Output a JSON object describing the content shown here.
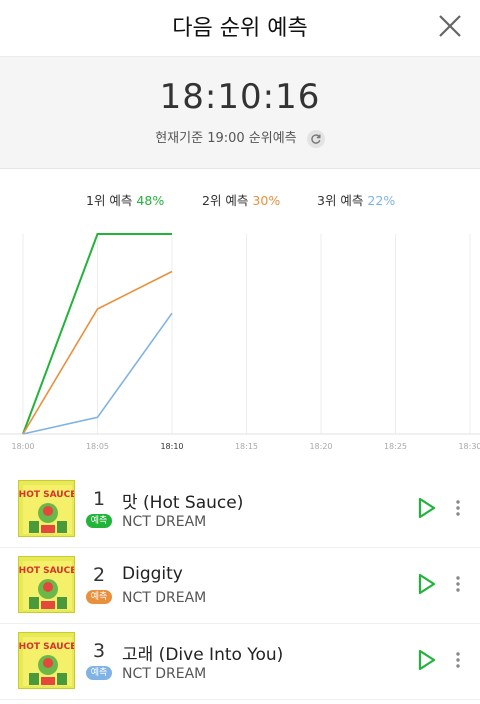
{
  "header": {
    "title": "다음 순위 예측",
    "close_icon": "close-icon"
  },
  "timer": {
    "clock": "18:10:16",
    "basis_text": "현재기준 19:00 순위예측",
    "refresh_icon": "refresh-icon"
  },
  "legend": [
    {
      "label": "1위 예측",
      "value": "48%",
      "color": "#22b33a"
    },
    {
      "label": "2위 예측",
      "value": "30%",
      "color": "#e9903d"
    },
    {
      "label": "3위 예측",
      "value": "22%",
      "color": "#7fb3e6"
    }
  ],
  "chart_data": {
    "type": "line",
    "x": [
      "18:00",
      "18:05",
      "18:10",
      "18:15",
      "18:20",
      "18:25",
      "18:30"
    ],
    "current_x": "18:10",
    "grid": "vertical",
    "series": [
      {
        "name": "1위 예측",
        "color": "#22b33a",
        "values": [
          0,
          48,
          48
        ]
      },
      {
        "name": "2위 예측",
        "color": "#e9903d",
        "values": [
          0,
          30,
          39
        ]
      },
      {
        "name": "3위 예측",
        "color": "#7fb3e6",
        "values": [
          0,
          4,
          29
        ]
      }
    ],
    "ylim": [
      0,
      48
    ]
  },
  "songs": [
    {
      "rank": "1",
      "title": "맛 (Hot Sauce)",
      "artist": "NCT DREAM",
      "badge": "예측",
      "badge_color": "#22b33a"
    },
    {
      "rank": "2",
      "title": "Diggity",
      "artist": "NCT DREAM",
      "badge": "예측",
      "badge_color": "#e9903d"
    },
    {
      "rank": "3",
      "title": "고래 (Dive Into You)",
      "artist": "NCT DREAM",
      "badge": "예측",
      "badge_color": "#7fb3e6"
    }
  ],
  "icons": {
    "play": "play-icon",
    "more": "more-vertical-icon",
    "album": "album-cover-image"
  }
}
